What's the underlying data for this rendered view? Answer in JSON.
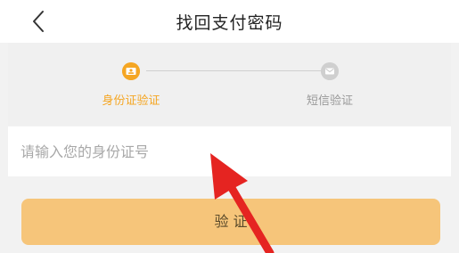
{
  "header": {
    "title": "找回支付密码"
  },
  "steps": [
    {
      "label": "身份证验证",
      "state": "active",
      "icon": "id-card-icon"
    },
    {
      "label": "短信验证",
      "state": "inactive",
      "icon": "message-icon"
    }
  ],
  "form": {
    "id_input_value": "",
    "id_input_placeholder": "请输入您的身份证号"
  },
  "verify_button": {
    "label": "验 证"
  },
  "annotation": {
    "arrow_color": "#e52421"
  },
  "colors": {
    "accent": "#f5a623",
    "button": "#f6c57a",
    "inactive": "#cfcfcf"
  }
}
